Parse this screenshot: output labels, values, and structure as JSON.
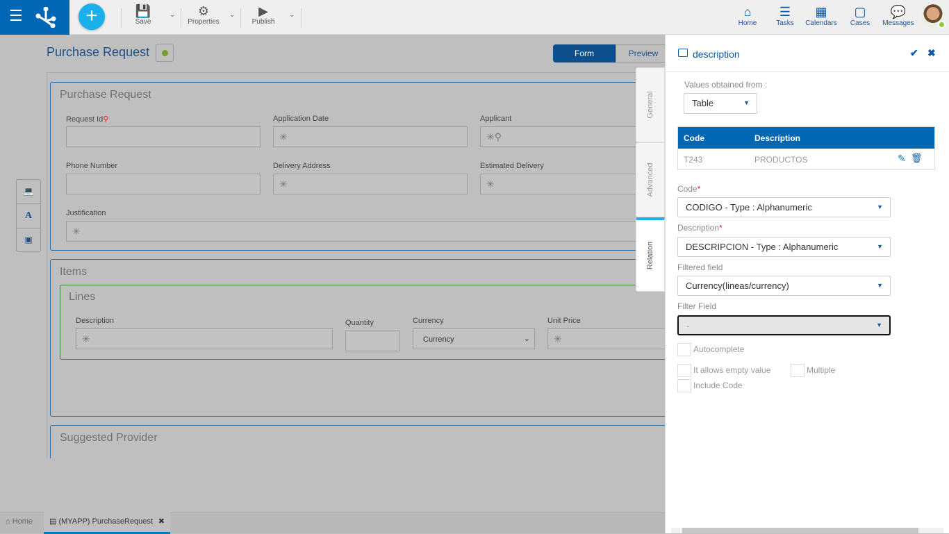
{
  "toolbar": {
    "save": "Save",
    "properties": "Properties",
    "publish": "Publish"
  },
  "nav": {
    "home": "Home",
    "tasks": "Tasks",
    "calendars": "Calendars",
    "cases": "Cases",
    "messages": "Messages"
  },
  "page": {
    "title": "Purchase Request",
    "view_form": "Form",
    "view_preview": "Preview"
  },
  "form": {
    "section1": {
      "title": "Purchase Request",
      "fields": {
        "request_id": "Request Id",
        "application_date": "Application Date",
        "applicant": "Applicant",
        "phone": "Phone Number",
        "delivery_address": "Delivery Address",
        "estimated_delivery": "Estimated Delivery",
        "justification": "Justification"
      }
    },
    "section2": {
      "title": "Items",
      "grid_title": "Lines",
      "columns": {
        "description": "Description",
        "quantity": "Quantity",
        "currency": "Currency",
        "unit_price": "Unit Price"
      },
      "currency_value": "Currency"
    },
    "section3": {
      "title": "Suggested Provider"
    }
  },
  "tabs": {
    "general": "General",
    "advanced": "Advanced",
    "relation": "Relation"
  },
  "panel": {
    "title": "description",
    "values_from_label": "Values obtained from :",
    "values_from": "Table",
    "table": {
      "headers": [
        "Code",
        "Description"
      ],
      "rows": [
        {
          "code": "T243",
          "description": "PRODUCTOS"
        }
      ]
    },
    "code_label": "Code",
    "code_value": "CODIGO - Type : Alphanumeric",
    "desc_label": "Description",
    "desc_value": "DESCRIPCION - Type : Alphanumeric",
    "filtered_label": "Filtered field",
    "filtered_value": "Currency(lineas/currency)",
    "filter_label": "Filter Field",
    "filter_value": "-",
    "autocomplete": "Autocomplete",
    "empty": "It allows empty value",
    "multiple": "Multiple",
    "include_code": "Include Code"
  },
  "bottom_tabs": {
    "home": "Home",
    "current": "(MYAPP) PurchaseRequest"
  },
  "colors": {
    "brand": "#0166b3",
    "accent": "#1ab0ec",
    "status": "#7a9a2a"
  }
}
